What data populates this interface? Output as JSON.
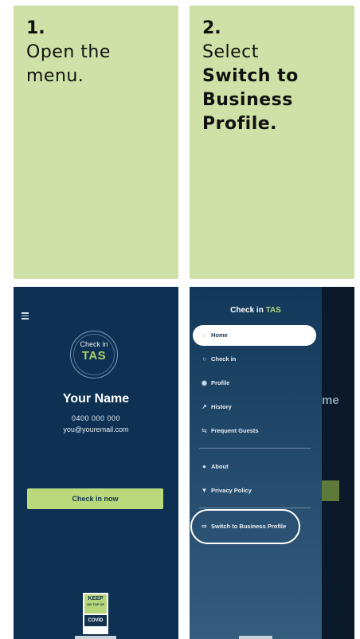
{
  "step1": {
    "number": "1.",
    "line1": "Open the",
    "line2": "menu."
  },
  "step2": {
    "number": "2.",
    "line1": "Select",
    "bold1": "Switch to",
    "bold2": "Business",
    "bold3": "Profile."
  },
  "home_screen": {
    "logo_top": "Check in",
    "logo_bottom": "TAS",
    "name": "Your Name",
    "phone": "0400 000 000",
    "email": "you@youremail.com",
    "checkin_button": "Check in now",
    "badge_top": "KEEP",
    "badge_small": "ON TOP OF",
    "badge_bottom": "COVID"
  },
  "drawer": {
    "title_prefix": "Check in ",
    "title_accent": "TAS",
    "items": [
      {
        "label": "Home",
        "icon": "home-icon"
      },
      {
        "label": "Check in",
        "icon": "globe-icon"
      },
      {
        "label": "Profile",
        "icon": "user-icon"
      },
      {
        "label": "History",
        "icon": "trend-icon"
      },
      {
        "label": "Frequent Guests",
        "icon": "people-icon"
      },
      {
        "label": "About",
        "icon": "info-icon"
      },
      {
        "label": "Privacy Policy",
        "icon": "shield-icon"
      },
      {
        "label": "Switch to Business Profile",
        "icon": "switch-icon"
      }
    ],
    "background_name_fragment": "me"
  },
  "colors": {
    "card": "#cfe1a6",
    "navy": "#0e3153",
    "accent": "#b3d47a"
  }
}
